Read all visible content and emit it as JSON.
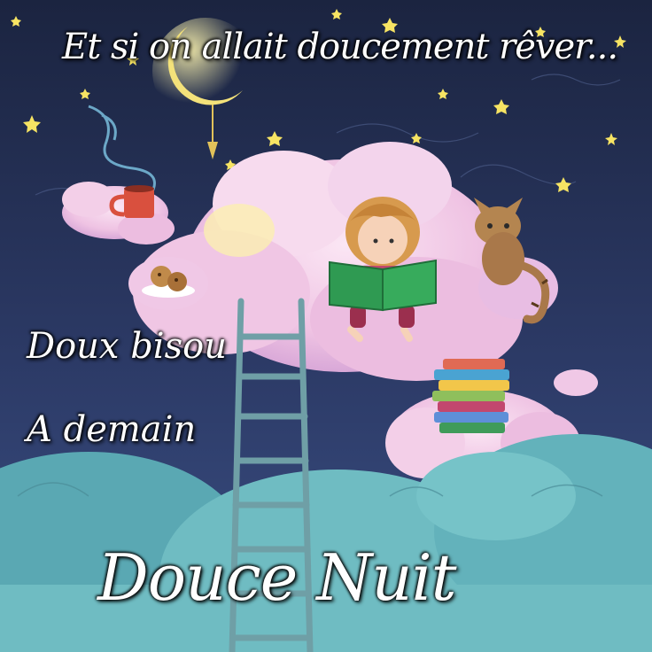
{
  "texts": {
    "title": "Et si on allait doucement rêver...",
    "line1": "Doux bisou",
    "line2": "A demain",
    "main": "Douce Nuit"
  },
  "colors": {
    "sky_top": "#1b2440",
    "sky_bottom": "#3a4f84",
    "cloud_pink": "#f2c8e6",
    "cloud_teal": "#6fbcc2",
    "moon": "#f4e27a",
    "star": "#f7e463",
    "book_green": "#2f9a52",
    "cat_brown": "#b48550",
    "ladder": "#6f9fa6",
    "text": "#ffffff"
  },
  "icons": [
    "moon-icon",
    "star-icon",
    "cup-icon",
    "cookie-icon",
    "book-icon",
    "cat-icon",
    "ladder-icon",
    "book-stack-icon"
  ]
}
